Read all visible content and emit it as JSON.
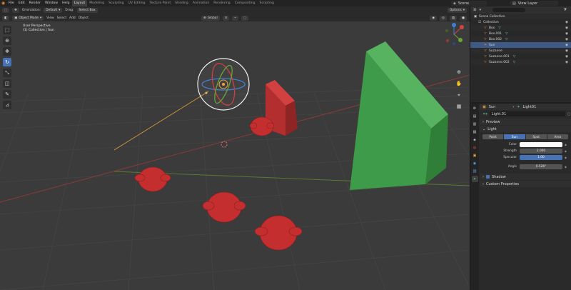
{
  "menu": {
    "items": [
      "File",
      "Edit",
      "Render",
      "Window",
      "Help"
    ],
    "workspaces": [
      "Layout",
      "Modeling",
      "Sculpting",
      "UV Editing",
      "Texture Paint",
      "Shading",
      "Animation",
      "Rendering",
      "Compositing",
      "Scripting"
    ],
    "active_workspace": "Layout",
    "scene": "Scene",
    "view_layer": "View Layer"
  },
  "header": {
    "orientation_label": "Orientation:",
    "orientation_value": "Default",
    "drag_label": "Drag:",
    "drag_value": "Select Box",
    "mode": "Object Mode",
    "view_menu": [
      "View",
      "Select",
      "Add",
      "Object"
    ],
    "transform_orientation": "Global",
    "options": "Options"
  },
  "viewport": {
    "info_line1": "User Perspective",
    "info_line2": "(1) Collection | Sun"
  },
  "outliner": {
    "root": "Scene Collection",
    "collection": "Collection",
    "items": [
      {
        "name": "Box",
        "selected": false
      },
      {
        "name": "Box.001",
        "selected": false
      },
      {
        "name": "Box.002",
        "selected": false
      },
      {
        "name": "Sun",
        "selected": true
      },
      {
        "name": "Suzanne",
        "selected": false
      },
      {
        "name": "Suzanne.001",
        "selected": false
      },
      {
        "name": "Suzanne.002",
        "selected": false
      }
    ]
  },
  "properties": {
    "object_name": "Sun",
    "data_name": "Light01",
    "light_name": "Light.01",
    "panels": {
      "preview": "Preview",
      "light": "Light",
      "shadow": "Shadow",
      "custom": "Custom Properties"
    },
    "light_types": [
      "Point",
      "Sun",
      "Spot",
      "Area"
    ],
    "active_light_type": "Sun",
    "color_label": "Color",
    "strength_label": "Strength",
    "strength_value": "2.000",
    "specular_label": "Specular",
    "specular_value": "1.00",
    "angle_label": "Angle",
    "angle_value": "0.526°"
  },
  "colors": {
    "accent": "#4772b3",
    "selection_orange": "#e28a2f",
    "mesh_red": "#c42b2b",
    "mesh_green": "#3f9e4a"
  }
}
